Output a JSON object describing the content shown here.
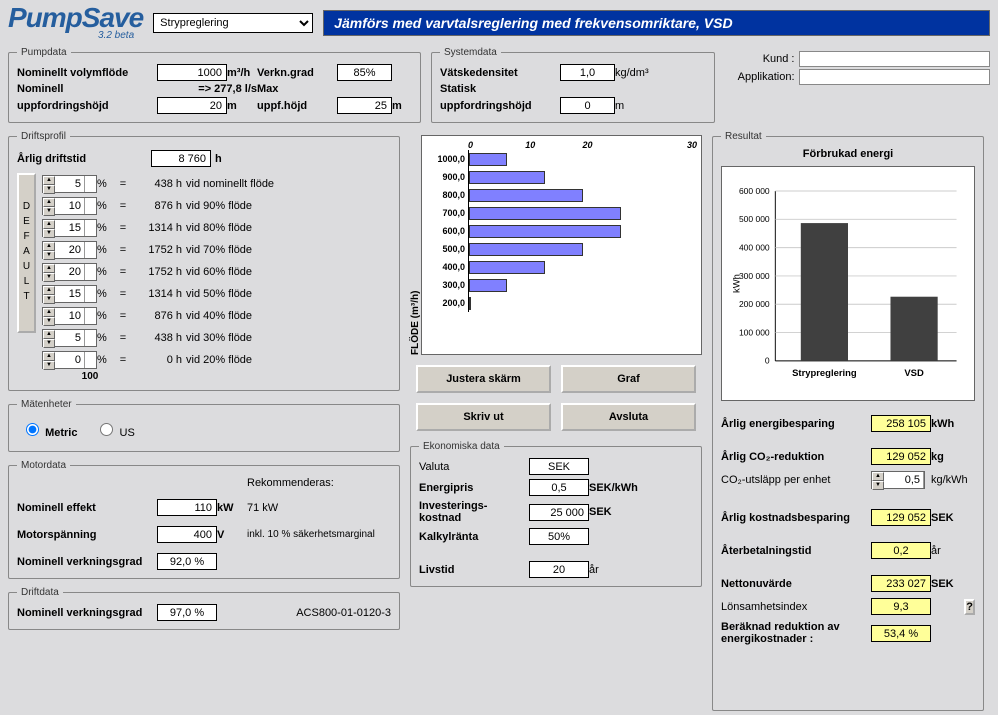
{
  "header": {
    "logo": "PumpSave",
    "version": "3.2 beta",
    "dropdown_value": "Strypreglering",
    "banner": "Jämförs med varvtalsreglering med frekvensomriktare, VSD"
  },
  "pumpdata": {
    "legend": "Pumpdata",
    "nom_flow_lbl": "Nominellt volymflöde",
    "nom_flow_val": "1000",
    "nom_flow_unit": "m³/h",
    "nom_flow_ls": "=> 277,8 l/s",
    "nom_head_lbl": "Nominell uppfordringshöjd",
    "nom_head_val": "20",
    "nom_head_unit": "m",
    "eff_lbl": "Verkn.grad",
    "eff_val": "85%",
    "max_head_lbl": "Max uppf.höjd",
    "max_head_val": "25",
    "max_head_unit": "m"
  },
  "systemdata": {
    "legend": "Systemdata",
    "density_lbl": "Vätskedensitet",
    "density_val": "1,0",
    "density_unit": "kg/dm³",
    "static_lbl": "Statisk uppfordringshöjd",
    "static_val": "0",
    "static_unit": "m"
  },
  "customer": {
    "kund_lbl": "Kund :",
    "app_lbl": "Applikation:",
    "kund_val": "",
    "app_val": ""
  },
  "driftsprofil": {
    "legend": "Driftsprofil",
    "annual_lbl": "Årlig driftstid",
    "annual_val": "8 760",
    "annual_unit": "h",
    "default_btn": "DEFAULT",
    "total": "100",
    "rows": [
      {
        "pct": "5",
        "hrs": "438 h",
        "desc": "vid nominellt flöde"
      },
      {
        "pct": "10",
        "hrs": "876 h",
        "desc": "vid 90% flöde"
      },
      {
        "pct": "15",
        "hrs": "1314 h",
        "desc": "vid 80% flöde"
      },
      {
        "pct": "20",
        "hrs": "1752 h",
        "desc": "vid 70% flöde"
      },
      {
        "pct": "20",
        "hrs": "1752 h",
        "desc": "vid 60% flöde"
      },
      {
        "pct": "15",
        "hrs": "1314 h",
        "desc": "vid 50% flöde"
      },
      {
        "pct": "10",
        "hrs": "876 h",
        "desc": "vid 40% flöde"
      },
      {
        "pct": "5",
        "hrs": "438 h",
        "desc": "vid 30% flöde"
      },
      {
        "pct": "0",
        "hrs": "0 h",
        "desc": "vid 20% flöde"
      }
    ]
  },
  "matenheter": {
    "legend": "Mätenheter",
    "metric": "Metric",
    "us": "US"
  },
  "motordata": {
    "legend": "Motordata",
    "rek_lbl": "Rekommenderas:",
    "rek_val": "71 kW",
    "rek_note": "inkl. 10 % säkerhetsmarginal",
    "power_lbl": "Nominell effekt",
    "power_val": "110",
    "power_unit": "kW",
    "volt_lbl": "Motorspänning",
    "volt_val": "400",
    "volt_unit": "V",
    "eff_lbl": "Nominell verkningsgrad",
    "eff_val": "92,0 %"
  },
  "driftdata": {
    "legend": "Driftdata",
    "eff_lbl": "Nominell verkningsgrad",
    "eff_val": "97,0 %",
    "model": "ACS800-01-0120-3"
  },
  "buttons": {
    "adjust": "Justera skärm",
    "graph": "Graf",
    "print": "Skriv ut",
    "quit": "Avsluta"
  },
  "ekonomiska": {
    "legend": "Ekonomiska data",
    "valuta_lbl": "Valuta",
    "valuta_val": "SEK",
    "energipris_lbl": "Energipris",
    "energipris_val": "0,5",
    "energipris_unit": "SEK/kWh",
    "invest_lbl": "Investerings-kostnad",
    "invest_val": "25 000",
    "invest_unit": "SEK",
    "kalkyl_lbl": "Kalkylränta",
    "kalkyl_val": "50%",
    "livstid_lbl": "Livstid",
    "livstid_val": "20",
    "livstid_unit": "år"
  },
  "resultat": {
    "legend": "Resultat",
    "chart_title": "Förbrukad energi",
    "ylabel": "kWh",
    "save_lbl": "Årlig energibesparing",
    "save_val": "258 105",
    "save_unit": "kWh",
    "co2_lbl": "Årlig CO₂-reduktion",
    "co2_val": "129 052",
    "co2_unit": "kg",
    "co2per_lbl": "CO₂-utsläpp per enhet",
    "co2per_val": "0,5",
    "co2per_unit": "kg/kWh",
    "cost_lbl": "Årlig kostnadsbesparing",
    "cost_val": "129 052",
    "cost_unit": "SEK",
    "payback_lbl": "Återbetalningstid",
    "payback_val": "0,2",
    "payback_unit": "år",
    "npv_lbl": "Nettonuvärde",
    "npv_val": "233 027",
    "npv_unit": "SEK",
    "profidx_lbl": "Lönsamhetsindex",
    "profidx_val": "9,3",
    "reduct_lbl": "Beräknad reduktion av energikostnader :",
    "reduct_val": "53,4 %",
    "help": "?"
  },
  "chart_data": [
    {
      "type": "bar",
      "orientation": "horizontal",
      "title": "",
      "xlabel": "",
      "ylabel": "FLÖDE (m³/h)",
      "xlim": [
        0,
        30
      ],
      "xticks": [
        0,
        10,
        20,
        30
      ],
      "categories": [
        "1000,0",
        "900,0",
        "800,0",
        "700,0",
        "600,0",
        "500,0",
        "400,0",
        "300,0",
        "200,0"
      ],
      "values": [
        5,
        10,
        15,
        20,
        20,
        15,
        10,
        5,
        0
      ]
    },
    {
      "type": "bar",
      "title": "Förbrukad energi",
      "ylabel": "kWh",
      "ylim": [
        0,
        600000
      ],
      "yticks": [
        0,
        100000,
        200000,
        300000,
        400000,
        500000,
        600000
      ],
      "categories": [
        "Strypreglering",
        "VSD"
      ],
      "values": [
        485000,
        227000
      ]
    }
  ]
}
